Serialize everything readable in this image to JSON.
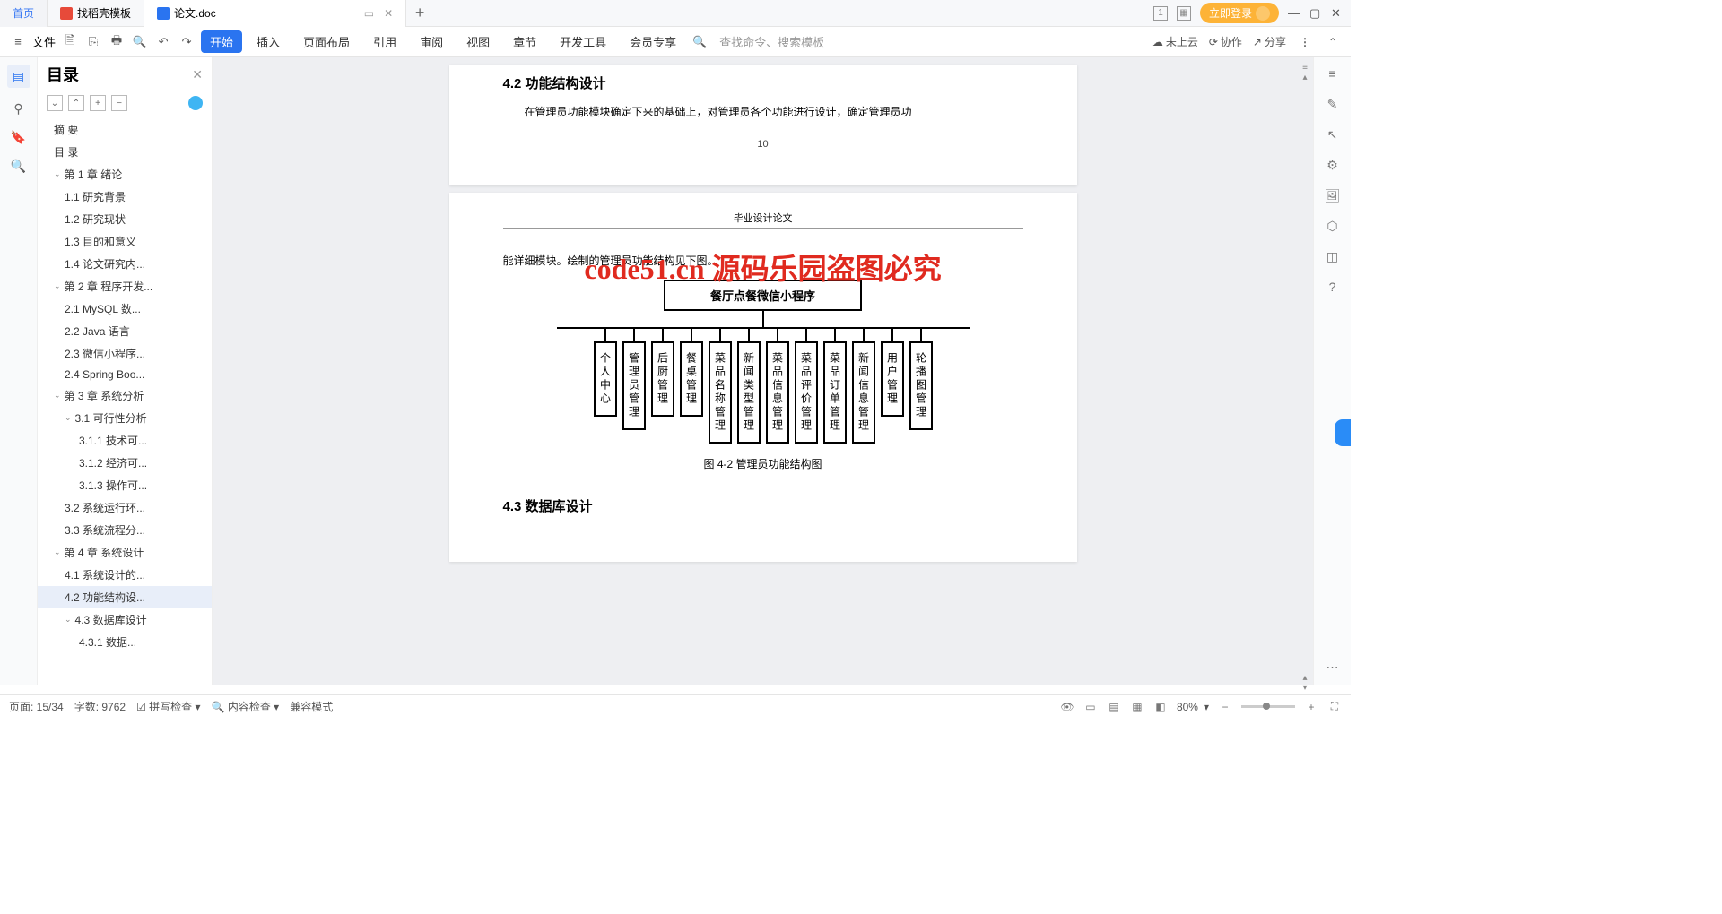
{
  "tabs": {
    "home": "首页",
    "template": "找稻壳模板",
    "doc": "论文.doc"
  },
  "login": "立即登录",
  "menu": {
    "file": "文件"
  },
  "ribbon": [
    "开始",
    "插入",
    "页面布局",
    "引用",
    "审阅",
    "视图",
    "章节",
    "开发工具",
    "会员专享"
  ],
  "searchCmd": "查找命令、搜索模板",
  "cloud": "未上云",
  "collab": "协作",
  "share": "分享",
  "outlineTitle": "目录",
  "toc": [
    {
      "t": "摘  要",
      "l": 1
    },
    {
      "t": "目  录",
      "l": 1
    },
    {
      "t": "第 1 章  绪论",
      "l": 1,
      "c": 1
    },
    {
      "t": "1.1 研究背景",
      "l": 2
    },
    {
      "t": "1.2 研究现状",
      "l": 2
    },
    {
      "t": "1.3 目的和意义",
      "l": 2
    },
    {
      "t": "1.4 论文研究内...",
      "l": 2
    },
    {
      "t": "第 2 章  程序开发...",
      "l": 1,
      "c": 1
    },
    {
      "t": "2.1 MySQL 数...",
      "l": 2
    },
    {
      "t": "2.2 Java 语言",
      "l": 2
    },
    {
      "t": "2.3 微信小程序...",
      "l": 2
    },
    {
      "t": "2.4 Spring Boo...",
      "l": 2
    },
    {
      "t": "第 3 章  系统分析",
      "l": 1,
      "c": 1
    },
    {
      "t": "3.1 可行性分析",
      "l": 2,
      "c": 1
    },
    {
      "t": "3.1.1 技术可...",
      "l": 3
    },
    {
      "t": "3.1.2 经济可...",
      "l": 3
    },
    {
      "t": "3.1.3 操作可...",
      "l": 3
    },
    {
      "t": "3.2 系统运行环...",
      "l": 2
    },
    {
      "t": "3.3 系统流程分...",
      "l": 2
    },
    {
      "t": "第 4 章  系统设计",
      "l": 1,
      "c": 1
    },
    {
      "t": "4.1 系统设计的...",
      "l": 2
    },
    {
      "t": "4.2 功能结构设...",
      "l": 2,
      "sel": 1
    },
    {
      "t": "4.3 数据库设计",
      "l": 2,
      "c": 1
    },
    {
      "t": "4.3.1 数据...",
      "l": 3
    }
  ],
  "page1": {
    "h": "4.2  功能结构设计",
    "body": "在管理员功能模块确定下来的基础上，对管理员各个功能进行设计，确定管理员功",
    "num": "10"
  },
  "page2": {
    "hdr": "毕业设计论文",
    "partial": "能详细模块。绘制的管理员功能结构见下图。",
    "root": "餐厅点餐微信小程序",
    "caption": "图 4-2  管理员功能结构图",
    "h3": "4.3  数据库设计"
  },
  "watermark": "code51.cn 源码乐园盗图必究",
  "nodes": [
    "个人中心",
    "管理员管理",
    "后厨管理",
    "餐桌管理",
    "菜品名称管理",
    "新闻类型管理",
    "菜品信息管理",
    "菜品评价管理",
    "菜品订单管理",
    "新闻信息管理",
    "用户管理",
    "轮播图管理"
  ],
  "status": {
    "page": "页面: 15/34",
    "words": "字数: 9762",
    "spell": "拼写检查",
    "content": "内容检查",
    "compat": "兼容模式",
    "zoom": "80%"
  }
}
